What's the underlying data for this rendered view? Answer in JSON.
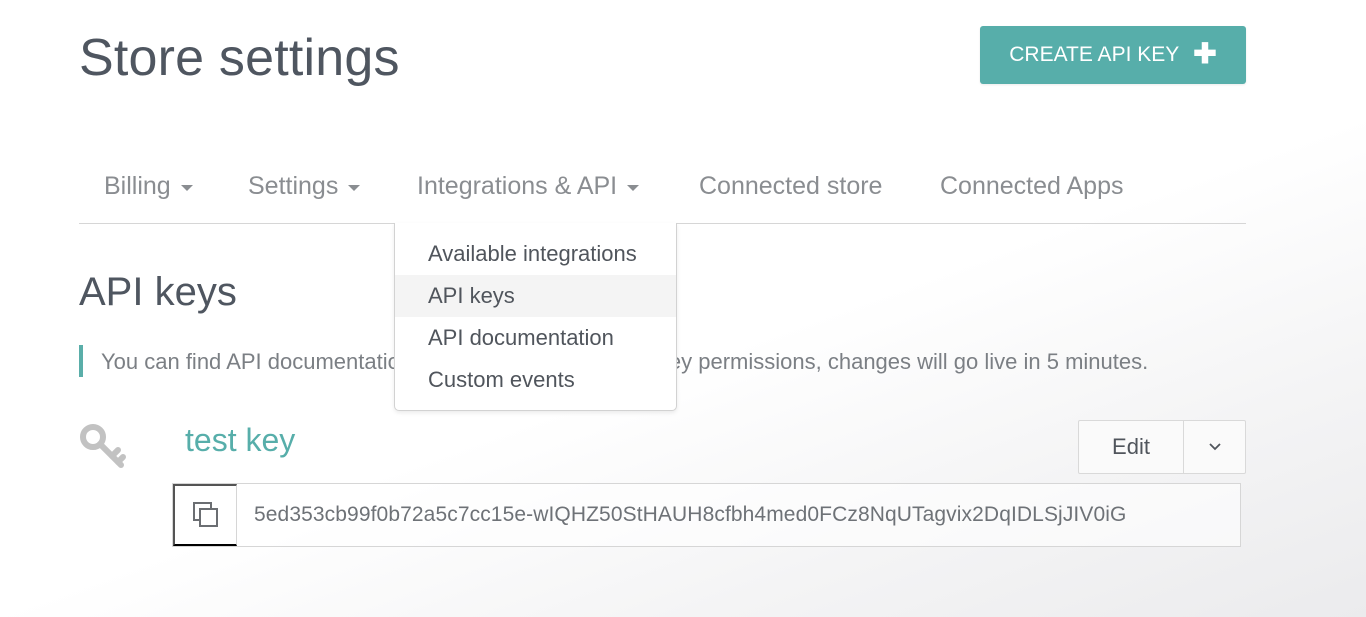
{
  "header": {
    "title": "Store settings",
    "create_button_label": "CREATE API KEY",
    "create_button_icon": "plus-icon"
  },
  "colors": {
    "accent": "#57aeaa",
    "text": "#4f5660",
    "muted": "#8a8d91"
  },
  "tabs": [
    {
      "label": "Billing",
      "has_dropdown": true
    },
    {
      "label": "Settings",
      "has_dropdown": true
    },
    {
      "label": "Integrations & API",
      "has_dropdown": true,
      "open": true
    },
    {
      "label": "Connected store",
      "has_dropdown": false
    },
    {
      "label": "Connected Apps",
      "has_dropdown": false
    }
  ],
  "dropdown": {
    "items": [
      {
        "label": "Available integrations",
        "active": false
      },
      {
        "label": "API keys",
        "active": true
      },
      {
        "label": "API documentation",
        "active": false
      },
      {
        "label": "Custom events",
        "active": false
      }
    ]
  },
  "section": {
    "title": "API keys",
    "notice": "You can find API documentation here. When you change key permissions, changes will go live in 5 minutes.",
    "notice_visible": "You can find API documentation here. When you change key permissions, changes will go live in 5 minutes."
  },
  "api_key": {
    "name": "test key",
    "icon": "key-icon",
    "edit_label": "Edit",
    "value": "5ed353cb99f0b72a5c7cc15e-wIQHZ50StHAUH8cfbh4med0FCz8NqUTagvix2DqIDLSjJIV0iG",
    "copy_icon": "copy-icon"
  }
}
